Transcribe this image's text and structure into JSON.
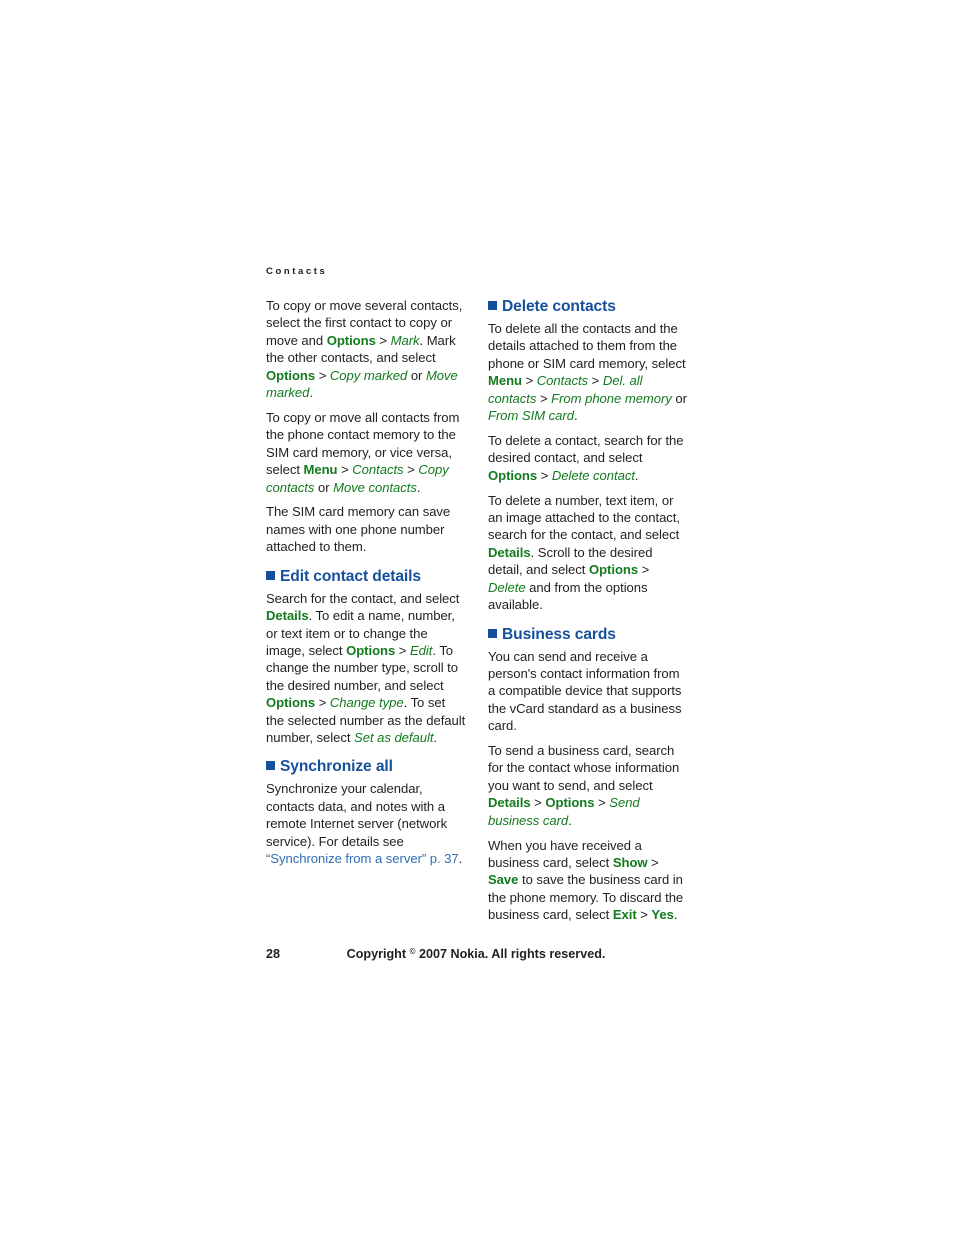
{
  "document": {
    "running_head": "Contacts",
    "page_number": "28",
    "copyright": {
      "prefix": "Copyright ",
      "symbol": "©",
      "suffix": " 2007 Nokia. All rights reserved."
    },
    "colors": {
      "heading_blue": "#16509b",
      "softkey_green": "#137a1e",
      "menu_item_green": "#137a1e",
      "cross_reference_blue": "#2f6fb5",
      "body_text": "#231f20",
      "page_background": "#ffffff"
    }
  },
  "left_column": {
    "paragraphs": {
      "copy_move_several": {
        "r1": "To copy or move several contacts, select the first contact to copy or move and ",
        "r2": "Options",
        "r3": " > ",
        "r4": "Mark",
        "r5": ". Mark the other contacts, and select ",
        "r6": "Options",
        "r7": " > ",
        "r8": "Copy marked",
        "r9": " or ",
        "r10": "Move marked",
        "r11": "."
      },
      "copy_move_all": {
        "r1": "To copy or move all contacts from the phone contact memory to the SIM card memory, or vice versa, select ",
        "r2": "Menu",
        "r3": " > ",
        "r4": "Contacts",
        "r5": " > ",
        "r6": "Copy contacts",
        "r7": " or ",
        "r8": "Move contacts",
        "r9": "."
      },
      "sim_memory_note": {
        "r1": "The SIM card memory can save names with one phone number attached to them."
      }
    },
    "sections": {
      "edit_contact_details": {
        "heading": "Edit contact details",
        "body": {
          "r1": "Search for the contact, and select ",
          "r2": "Details",
          "r3": ". To edit a name, number, or text item or to change the image, select ",
          "r4": "Options",
          "r5": " > ",
          "r6": "Edit",
          "r7": ". To change the number type, scroll to the desired number, and select ",
          "r8": "Options",
          "r9": " > ",
          "r10": "Change type",
          "r11": ". To set the selected number as the default number, select ",
          "r12": "Set as default",
          "r13": "."
        }
      },
      "synchronize_all": {
        "heading": "Synchronize all",
        "body": {
          "r1": "Synchronize your calendar, contacts data, and notes with a remote Internet server (network service). For details see ",
          "r2": "“Synchronize from a server” p. 37",
          "r3": "."
        }
      }
    }
  },
  "right_column": {
    "sections": {
      "delete_contacts": {
        "heading": "Delete contacts",
        "body_1": {
          "r1": "To delete all the contacts and the details attached to them from the phone or SIM card memory, select ",
          "r2": "Menu",
          "r3": " > ",
          "r4": "Contacts",
          "r5": " > ",
          "r6": "Del. all contacts",
          "r7": " > ",
          "r8": "From phone memory",
          "r9": " or ",
          "r10": "From SIM card",
          "r11": "."
        },
        "body_2": {
          "r1": "To delete a contact, search for the desired contact, and select ",
          "r2": "Options",
          "r3": " > ",
          "r4": "Delete contact",
          "r5": "."
        },
        "body_3": {
          "r1": "To delete a number, text item, or an image attached to the contact, search for the contact, and select ",
          "r2": "Details",
          "r3": ". Scroll to the desired detail, and select ",
          "r4": "Options",
          "r5": " > ",
          "r6": "Delete",
          "r7": " and from the options available."
        }
      },
      "business_cards": {
        "heading": "Business cards",
        "body_1": {
          "r1": "You can send and receive a person's contact information from a compatible device that supports the vCard standard as a business card."
        },
        "body_2": {
          "r1": "To send a business card, search for the contact whose information you want to send, and select ",
          "r2": "Details",
          "r3": " > ",
          "r4": "Options",
          "r5": " > ",
          "r6": "Send business card",
          "r7": "."
        },
        "body_3": {
          "r1": "When you have received a business card, select ",
          "r2": "Show",
          "r3": " > ",
          "r4": "Save",
          "r5": " to save the business card in the phone memory. To discard the business card, select ",
          "r6": "Exit",
          "r7": " > ",
          "r8": "Yes",
          "r9": "."
        }
      }
    }
  }
}
